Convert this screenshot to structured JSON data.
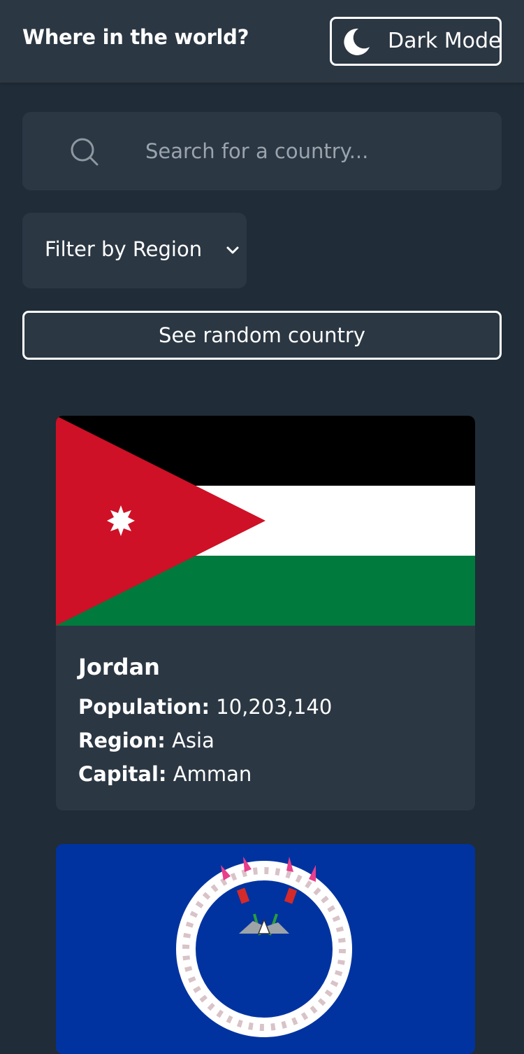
{
  "header": {
    "title": "Where in the world?",
    "mode_label": "Dark Mode"
  },
  "search": {
    "placeholder": "Search for a country..."
  },
  "filter": {
    "label": "Filter by Region"
  },
  "random_button": {
    "label": "See random country"
  },
  "countries": [
    {
      "name": "Jordan",
      "population_label": "Population:",
      "population": "10,203,140",
      "region_label": "Region:",
      "region": "Asia",
      "capital_label": "Capital:",
      "capital": "Amman"
    }
  ],
  "colors": {
    "background": "#202c37",
    "element": "#2b3743",
    "text": "#ffffff",
    "placeholder": "#9aa4ae"
  }
}
